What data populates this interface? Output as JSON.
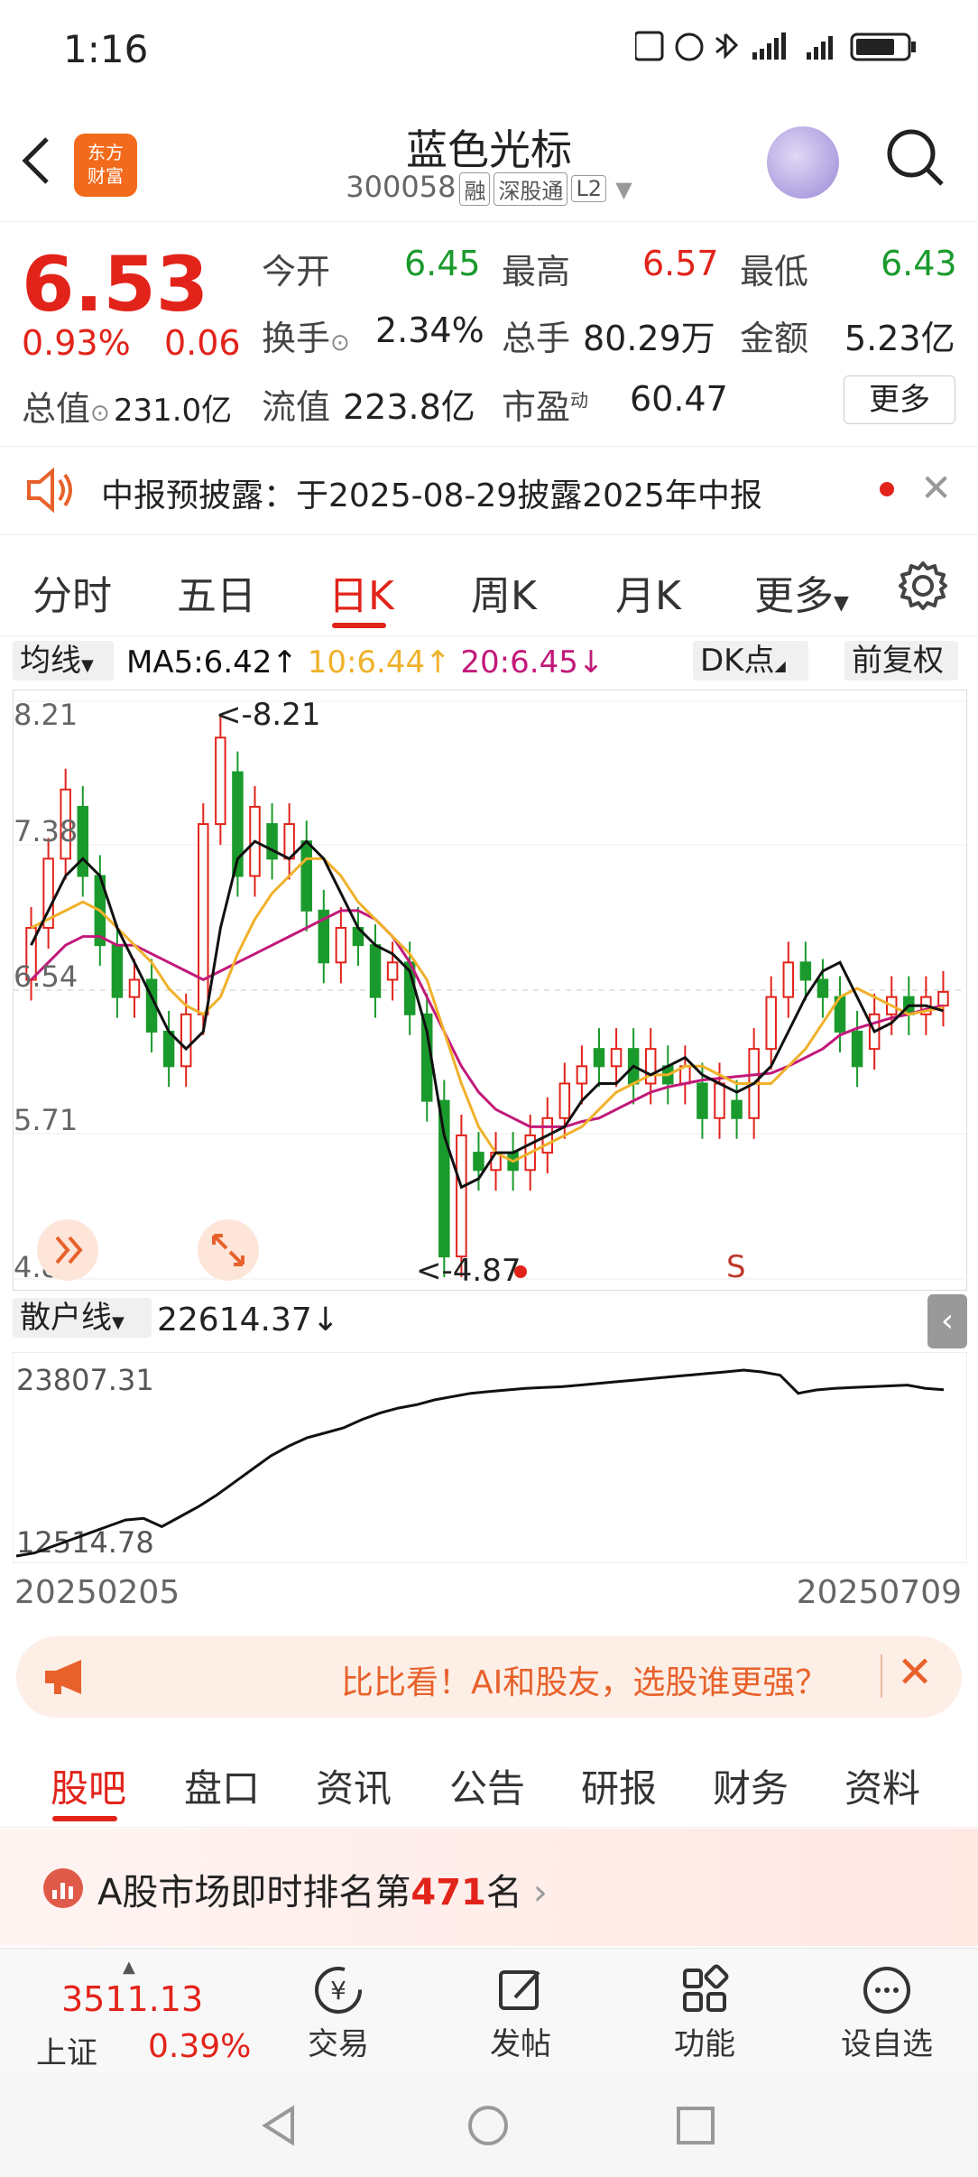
{
  "status_bar": {
    "time": "1:16",
    "icons": "NFC alarm bluetooth signal signal battery"
  },
  "header": {
    "back_icon": "back-arrow-icon",
    "logo_line1": "东方",
    "logo_line2": "财富",
    "stock_name": "蓝色光标",
    "stock_code": "300058",
    "tags": [
      "融",
      "深股通",
      "L2"
    ]
  },
  "quote": {
    "price": "6.53",
    "change_pct": "0.93%",
    "change_amt": "0.06",
    "open_label": "今开",
    "open": "6.45",
    "high_label": "最高",
    "high": "6.57",
    "low_label": "最低",
    "low": "6.43",
    "turnover_label": "换手",
    "turnover": "2.34%",
    "volume_label": "总手",
    "volume": "80.29万",
    "amount_label": "金额",
    "amount": "5.23亿",
    "total_cap_label": "总值",
    "total_cap": "231.0亿",
    "float_cap_label": "流值",
    "float_cap": "223.8亿",
    "pe_label": "市盈",
    "pe_sup": "动",
    "pe": "60.47",
    "more_label": "更多"
  },
  "notice": {
    "text": "中报预披露：于2025-08-29披露2025年中报"
  },
  "chart_tabs": [
    "分时",
    "五日",
    "日K",
    "周K",
    "月K",
    "更多"
  ],
  "indicator": {
    "ma_select": "均线",
    "ma5": "MA5:6.42↑",
    "ma10": "10:6.44↑",
    "ma20": "20:6.45↓",
    "dk_label": "DK点",
    "adjust_label": "前复权"
  },
  "chart_data": {
    "type": "candlestick",
    "y_ticks": [
      "8.21",
      "7.38",
      "6.54",
      "5.71",
      "4.87"
    ],
    "ylim": [
      4.87,
      8.21
    ],
    "max_annotation": "<-8.21",
    "min_annotation": "<-4.87",
    "signal_label": "S",
    "series_colors": {
      "ma5": "#111111",
      "ma10": "#f0b12a",
      "ma20": "#c2197a",
      "up": "#e2231a",
      "down": "#1a9a2c"
    },
    "ma5": [
      6.8,
      7.0,
      7.2,
      7.3,
      7.2,
      6.9,
      6.7,
      6.5,
      6.3,
      6.2,
      6.3,
      6.9,
      7.3,
      7.4,
      7.35,
      7.3,
      7.4,
      7.3,
      7.1,
      6.9,
      6.8,
      6.75,
      6.65,
      6.3,
      5.7,
      5.4,
      5.45,
      5.6,
      5.6,
      5.65,
      5.7,
      5.75,
      5.9,
      6.0,
      6.0,
      6.1,
      6.05,
      6.1,
      6.15,
      6.05,
      6.0,
      5.95,
      6.0,
      6.1,
      6.3,
      6.5,
      6.65,
      6.7,
      6.5,
      6.3,
      6.35,
      6.45,
      6.45,
      6.42
    ],
    "ma10": [
      6.9,
      6.95,
      7.0,
      7.05,
      7.0,
      6.9,
      6.8,
      6.7,
      6.55,
      6.45,
      6.4,
      6.5,
      6.75,
      6.95,
      7.1,
      7.2,
      7.3,
      7.3,
      7.2,
      7.05,
      6.95,
      6.85,
      6.75,
      6.6,
      6.3,
      6.0,
      5.75,
      5.6,
      5.55,
      5.6,
      5.65,
      5.7,
      5.75,
      5.85,
      5.95,
      6.0,
      6.05,
      6.05,
      6.1,
      6.1,
      6.05,
      6.0,
      6.0,
      6.0,
      6.1,
      6.2,
      6.35,
      6.5,
      6.55,
      6.5,
      6.45,
      6.4,
      6.42,
      6.44
    ],
    "ma20": [
      6.6,
      6.7,
      6.8,
      6.85,
      6.85,
      6.8,
      6.8,
      6.75,
      6.7,
      6.65,
      6.6,
      6.65,
      6.7,
      6.75,
      6.8,
      6.85,
      6.9,
      6.95,
      7.0,
      7.0,
      6.95,
      6.85,
      6.7,
      6.5,
      6.3,
      6.1,
      5.95,
      5.85,
      5.8,
      5.75,
      5.75,
      5.75,
      5.78,
      5.8,
      5.85,
      5.9,
      5.95,
      5.98,
      6.0,
      6.02,
      6.03,
      6.04,
      6.05,
      6.06,
      6.1,
      6.15,
      6.2,
      6.28,
      6.32,
      6.35,
      6.38,
      6.4,
      6.43,
      6.45
    ],
    "candles": [
      [
        6.6,
        6.9
      ],
      [
        6.9,
        7.3
      ],
      [
        7.3,
        7.7
      ],
      [
        7.6,
        7.2
      ],
      [
        7.2,
        6.8
      ],
      [
        6.8,
        6.5
      ],
      [
        6.5,
        6.6
      ],
      [
        6.6,
        6.3
      ],
      [
        6.3,
        6.1
      ],
      [
        6.1,
        6.4
      ],
      [
        6.4,
        7.5
      ],
      [
        7.5,
        8.0
      ],
      [
        7.8,
        7.2
      ],
      [
        7.2,
        7.6
      ],
      [
        7.5,
        7.3
      ],
      [
        7.3,
        7.5
      ],
      [
        7.4,
        7.0
      ],
      [
        7.0,
        6.7
      ],
      [
        6.7,
        6.9
      ],
      [
        6.9,
        6.8
      ],
      [
        6.8,
        6.5
      ],
      [
        6.6,
        6.7
      ],
      [
        6.7,
        6.4
      ],
      [
        6.4,
        5.9
      ],
      [
        5.9,
        5.0
      ],
      [
        5.0,
        5.7
      ],
      [
        5.6,
        5.5
      ],
      [
        5.5,
        5.6
      ],
      [
        5.6,
        5.5
      ],
      [
        5.5,
        5.7
      ],
      [
        5.6,
        5.8
      ],
      [
        5.8,
        6.0
      ],
      [
        6.0,
        6.1
      ],
      [
        6.2,
        6.1
      ],
      [
        6.1,
        6.2
      ],
      [
        6.2,
        6.0
      ],
      [
        6.0,
        6.2
      ],
      [
        6.1,
        6.0
      ],
      [
        6.0,
        6.1
      ],
      [
        6.0,
        5.8
      ],
      [
        5.8,
        6.0
      ],
      [
        5.9,
        5.8
      ],
      [
        5.8,
        6.2
      ],
      [
        6.2,
        6.5
      ],
      [
        6.5,
        6.7
      ],
      [
        6.7,
        6.6
      ],
      [
        6.6,
        6.5
      ],
      [
        6.5,
        6.3
      ],
      [
        6.3,
        6.1
      ],
      [
        6.2,
        6.4
      ],
      [
        6.4,
        6.5
      ],
      [
        6.5,
        6.4
      ],
      [
        6.4,
        6.5
      ],
      [
        6.45,
        6.53
      ]
    ]
  },
  "sub_chart": {
    "select": "散户线",
    "value": "22614.37↓",
    "y_max": "23807.31",
    "y_min": "12514.78",
    "line": [
      12514,
      12700,
      13100,
      13500,
      13900,
      14300,
      14700,
      14800,
      14300,
      14900,
      15500,
      16200,
      17000,
      17800,
      18600,
      19200,
      19700,
      20000,
      20300,
      20800,
      21200,
      21500,
      21700,
      22000,
      22200,
      22400,
      22500,
      22600,
      22700,
      22750,
      22800,
      22900,
      23000,
      23100,
      23200,
      23300,
      23400,
      23500,
      23600,
      23700,
      23807,
      23700,
      23500,
      22400,
      22600,
      22700,
      22750,
      22800,
      22850,
      22900,
      22700,
      22614
    ]
  },
  "dates": {
    "start": "20250205",
    "end": "20250709"
  },
  "promo": {
    "text": "比比看！AI和股友，选股谁更强？"
  },
  "info_tabs": [
    "股吧",
    "盘口",
    "资讯",
    "公告",
    "研报",
    "财务",
    "资料"
  ],
  "rank": {
    "prefix": "A股市场即时排名第",
    "rank": "471",
    "suffix": "名"
  },
  "bottom_bar": {
    "index_value": "3511.13",
    "index_name": "上证",
    "index_change": "0.39%",
    "buttons": [
      {
        "label": "交易",
        "icon": "trade-icon"
      },
      {
        "label": "发帖",
        "icon": "post-icon"
      },
      {
        "label": "功能",
        "icon": "function-grid-icon"
      },
      {
        "label": "设自选",
        "icon": "add-watchlist-icon"
      }
    ]
  }
}
